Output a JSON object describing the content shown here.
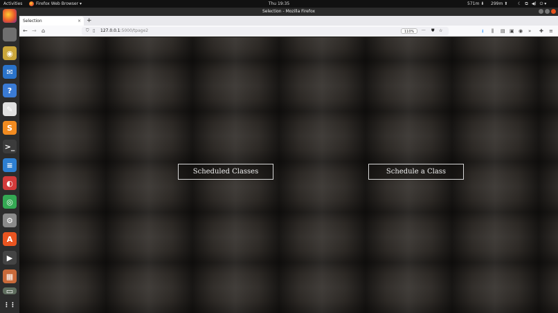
{
  "system_bar": {
    "activities": "Activities",
    "app_name": "Firefox Web Browser ▾",
    "clock": "Thu 19:35",
    "net_down": "571m",
    "net_up": "299m"
  },
  "dock": [
    {
      "name": "firefox-icon",
      "glyph": "",
      "color": "#e66000"
    },
    {
      "name": "files-icon",
      "glyph": "",
      "color": "#6f6f6f"
    },
    {
      "name": "rhythmbox-icon",
      "glyph": "◉",
      "color": "#caa63a"
    },
    {
      "name": "thunderbird-icon",
      "glyph": "✉",
      "color": "#2a73c9"
    },
    {
      "name": "help-icon",
      "glyph": "?",
      "color": "#3a7bd5"
    },
    {
      "name": "text-editor-icon",
      "glyph": "✎",
      "color": "#e0e0e0"
    },
    {
      "name": "sublime-text-icon",
      "glyph": "S",
      "color": "#f28b20"
    },
    {
      "name": "terminal-icon",
      "glyph": ">_",
      "color": "#3b3b3b"
    },
    {
      "name": "libreoffice-writer-icon",
      "glyph": "≡",
      "color": "#2d7fd2"
    },
    {
      "name": "rhythm-app-icon",
      "glyph": "◐",
      "color": "#d33a3a"
    },
    {
      "name": "chrome-icon",
      "glyph": "◎",
      "color": "#34a853"
    },
    {
      "name": "settings-icon",
      "glyph": "⚙",
      "color": "#8a8a8a"
    },
    {
      "name": "software-center-icon",
      "glyph": "A",
      "color": "#e95420"
    },
    {
      "name": "video-editor-icon",
      "glyph": "▶",
      "color": "#444444"
    },
    {
      "name": "archive-icon",
      "glyph": "▦",
      "color": "#c96a3a"
    },
    {
      "name": "drive-icon",
      "glyph": "▭",
      "color": "#5f6e5f"
    },
    {
      "name": "show-apps-icon",
      "glyph": "⋮⋮",
      "color": "#2c2c2c"
    }
  ],
  "browser": {
    "window_title": "Selection - Mozilla Firefox",
    "tab_title": "Selection",
    "tab_close": "×",
    "new_tab": "+",
    "url_host": "127.0.0.1",
    "url_path": ":5000/tpage2",
    "zoom": "110%",
    "page_actions": "···"
  },
  "page": {
    "button_left": "Scheduled Classes",
    "button_right": "Schedule a Class"
  }
}
